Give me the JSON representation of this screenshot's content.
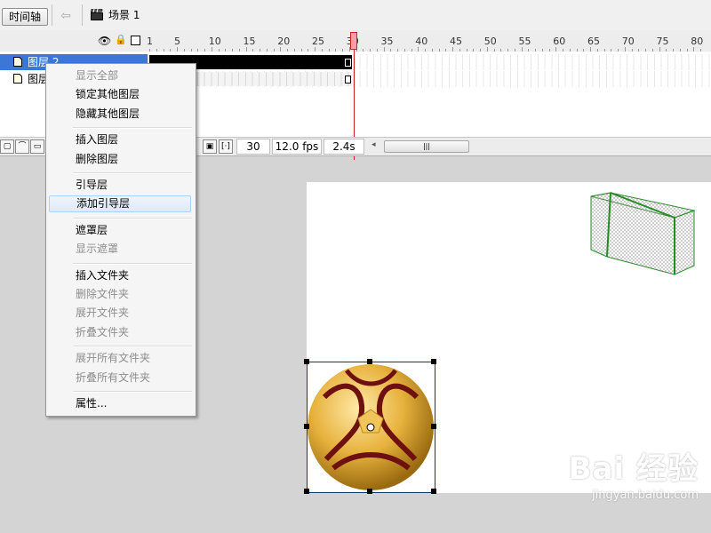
{
  "topbar": {
    "timeline_label": "时间轴",
    "back_icon": "arrow-left-icon",
    "scene_icon": "clapperboard-icon",
    "scene_label": "场景 1"
  },
  "timeline": {
    "header_icons": [
      "eye-icon",
      "lock-icon",
      "outline-icon"
    ],
    "ruler_labels": [
      "1",
      "5",
      "10",
      "15",
      "20",
      "25",
      "30",
      "35",
      "40",
      "45",
      "50",
      "55",
      "60",
      "65",
      "70",
      "75",
      "80"
    ],
    "layers": [
      {
        "name": "图层 2",
        "selected": true
      },
      {
        "name": "图层 1",
        "selected": false
      }
    ],
    "status": {
      "current_frame": "30",
      "frame_rate": "12.0 fps",
      "elapsed": "2.4s"
    },
    "selected_color": "#3a78d6",
    "playhead_color": "#d02030"
  },
  "context_menu": {
    "groups": [
      [
        {
          "label": "显示全部",
          "disabled": true
        },
        {
          "label": "锁定其他图层",
          "disabled": false
        },
        {
          "label": "隐藏其他图层",
          "disabled": false
        }
      ],
      [
        {
          "label": "插入图层",
          "disabled": false
        },
        {
          "label": "删除图层",
          "disabled": false
        }
      ],
      [
        {
          "label": "引导层",
          "disabled": false
        },
        {
          "label": "添加引导层",
          "disabled": false,
          "hover": true
        }
      ],
      [
        {
          "label": "遮罩层",
          "disabled": false
        },
        {
          "label": "显示遮罩",
          "disabled": true
        }
      ],
      [
        {
          "label": "插入文件夹",
          "disabled": false
        },
        {
          "label": "删除文件夹",
          "disabled": true
        },
        {
          "label": "展开文件夹",
          "disabled": true
        },
        {
          "label": "折叠文件夹",
          "disabled": true
        }
      ],
      [
        {
          "label": "展开所有文件夹",
          "disabled": true
        },
        {
          "label": "折叠所有文件夹",
          "disabled": true
        }
      ],
      [
        {
          "label": "属性...",
          "disabled": false
        }
      ]
    ]
  },
  "stage": {
    "objects": [
      "soccer-goal",
      "soccer-ball"
    ]
  },
  "watermark": {
    "logo": "Bai 经验",
    "url": "jingyan.baidu.com"
  }
}
